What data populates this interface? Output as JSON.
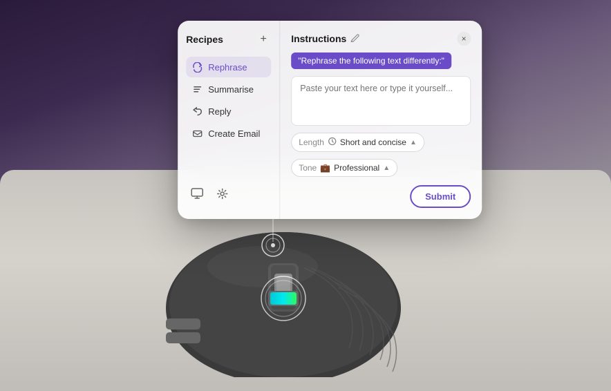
{
  "background": {
    "gradient_desc": "dark purple to gray"
  },
  "popup": {
    "recipes_panel": {
      "title": "Recipes",
      "add_button_label": "+",
      "items": [
        {
          "id": "rephrase",
          "label": "Rephrase",
          "icon": "↺",
          "active": true
        },
        {
          "id": "summarise",
          "label": "Summarise",
          "icon": "≡",
          "active": false
        },
        {
          "id": "reply",
          "label": "Reply",
          "icon": "↩",
          "active": false
        },
        {
          "id": "create-email",
          "label": "Create Email",
          "icon": "✉",
          "active": false
        }
      ],
      "footer_icons": [
        {
          "id": "monitor",
          "icon": "🖥"
        },
        {
          "id": "settings",
          "icon": "⚙"
        }
      ]
    },
    "instructions_panel": {
      "title": "Instructions",
      "edit_icon": "✏",
      "close_icon": "×",
      "instruction_badge": "\"Rephrase the following text differently:\"",
      "textarea_placeholder": "Paste your text here or type it yourself...",
      "length_label": "Length",
      "length_value": "Short and concise",
      "tone_label": "Tone",
      "tone_value": "Professional",
      "submit_label": "Submit"
    }
  }
}
